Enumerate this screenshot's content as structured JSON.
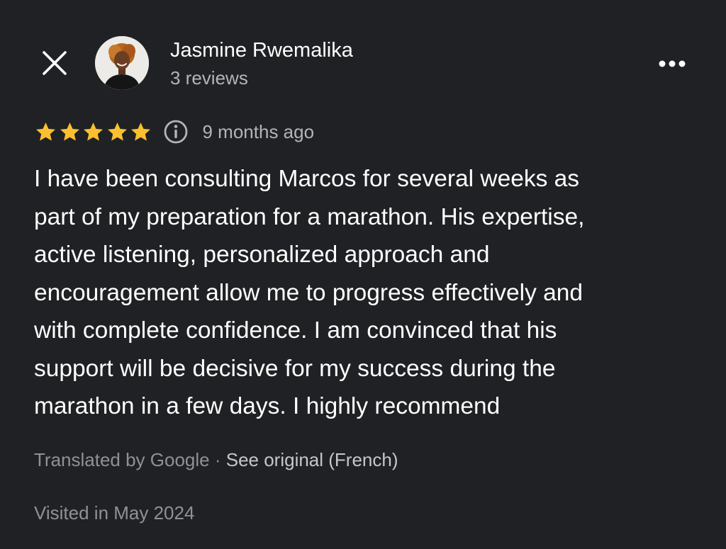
{
  "header": {
    "close_icon": "close-icon",
    "more_icon": "more-horizontal-icon",
    "author": {
      "name": "Jasmine Rwemalika",
      "reviews_count": "3 reviews",
      "avatar": "profile-photo"
    }
  },
  "review": {
    "rating": 5,
    "max_rating": 5,
    "star_color": "#fbc02d",
    "info_icon": "info-icon",
    "date": "9 months ago",
    "text": "I have been consulting Marcos for several weeks as\npart of my preparation for a marathon. His expertise,\nactive listening, personalized approach and\nencouragement allow me to progress effectively and\nwith complete confidence. I am convinced that his\nsupport will be decisive for my success during the\nmarathon in a few days. I highly recommend",
    "translation": {
      "label": "Translated by Google",
      "separator": " · ",
      "see_original": "See original (French)"
    },
    "visited": "Visited in May 2024"
  },
  "colors": {
    "background": "#202124",
    "primary_text": "#ffffff",
    "secondary_text": "#b1b4b9",
    "muted_text": "#8e9196"
  }
}
